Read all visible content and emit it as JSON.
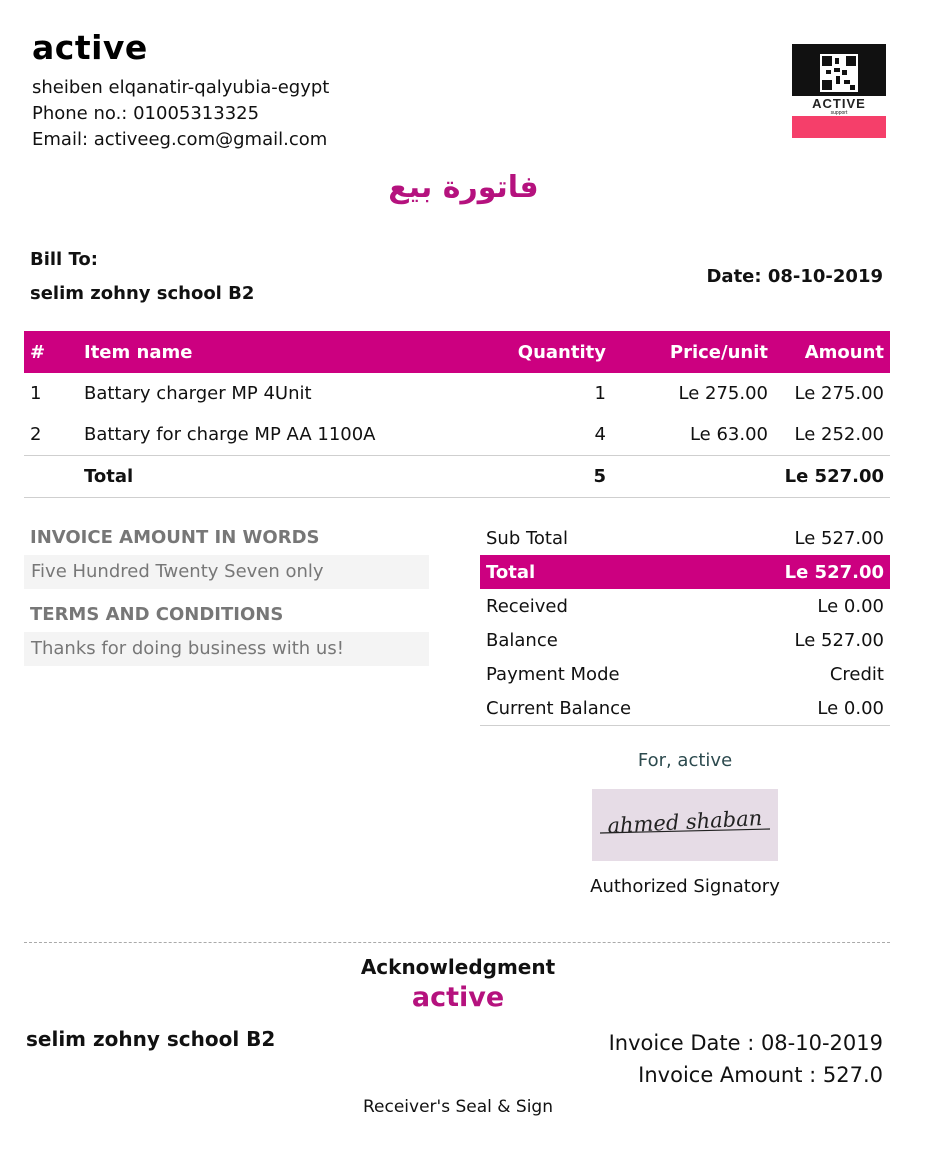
{
  "company": {
    "name": "active",
    "address": "sheiben elqanatir-qalyubia-egypt",
    "phone": "Phone no.: 01005313325",
    "email": "Email: activeeg.com@gmail.com",
    "logo_text": "ACTIVE",
    "logo_subtext": "support"
  },
  "invoice_title": "فاتورة بيع",
  "bill_to": {
    "label": "Bill To:",
    "name": "selim zohny school B2"
  },
  "date": "Date: 08-10-2019",
  "items_table": {
    "headers": [
      "#",
      "Item name",
      "Quantity",
      "Price/unit",
      "Amount"
    ],
    "rows": [
      [
        "1",
        "Battary charger MP 4Unit",
        "1",
        "Le 275.00",
        "Le 275.00"
      ],
      [
        "2",
        "Battary for charge MP AA 1100A",
        "4",
        "Le 63.00",
        "Le 252.00"
      ]
    ],
    "total": {
      "label": "Total",
      "quantity": "5",
      "amount": "Le 527.00"
    }
  },
  "words_section": {
    "heading": "INVOICE AMOUNT IN WORDS",
    "text": "Five Hundred Twenty Seven only"
  },
  "terms_section": {
    "heading": "TERMS AND CONDITIONS",
    "text": "Thanks for doing business with us!"
  },
  "summary": [
    [
      "Sub Total",
      "Le 527.00"
    ],
    [
      "Total",
      "Le 527.00"
    ],
    [
      "Received",
      "Le 0.00"
    ],
    [
      "Balance",
      "Le 527.00"
    ],
    [
      "Payment Mode",
      "Credit"
    ],
    [
      "Current Balance",
      "Le 0.00"
    ]
  ],
  "signature": {
    "for_line": "For, active",
    "signature_text": "ahmed shaban",
    "label": "Authorized Signatory"
  },
  "acknowledgment": {
    "title": "Acknowledgment",
    "company": "active",
    "bill_name": "selim zohny school B2",
    "invoice_date": "Invoice Date : 08-10-2019",
    "invoice_amount": "Invoice Amount : 527.0",
    "receiver": "Receiver's Seal & Sign"
  },
  "colors": {
    "accent": "#cc0080",
    "title_magenta": "#b5127e",
    "muted_gray": "#777777",
    "logo_pink": "#f53f6a"
  }
}
